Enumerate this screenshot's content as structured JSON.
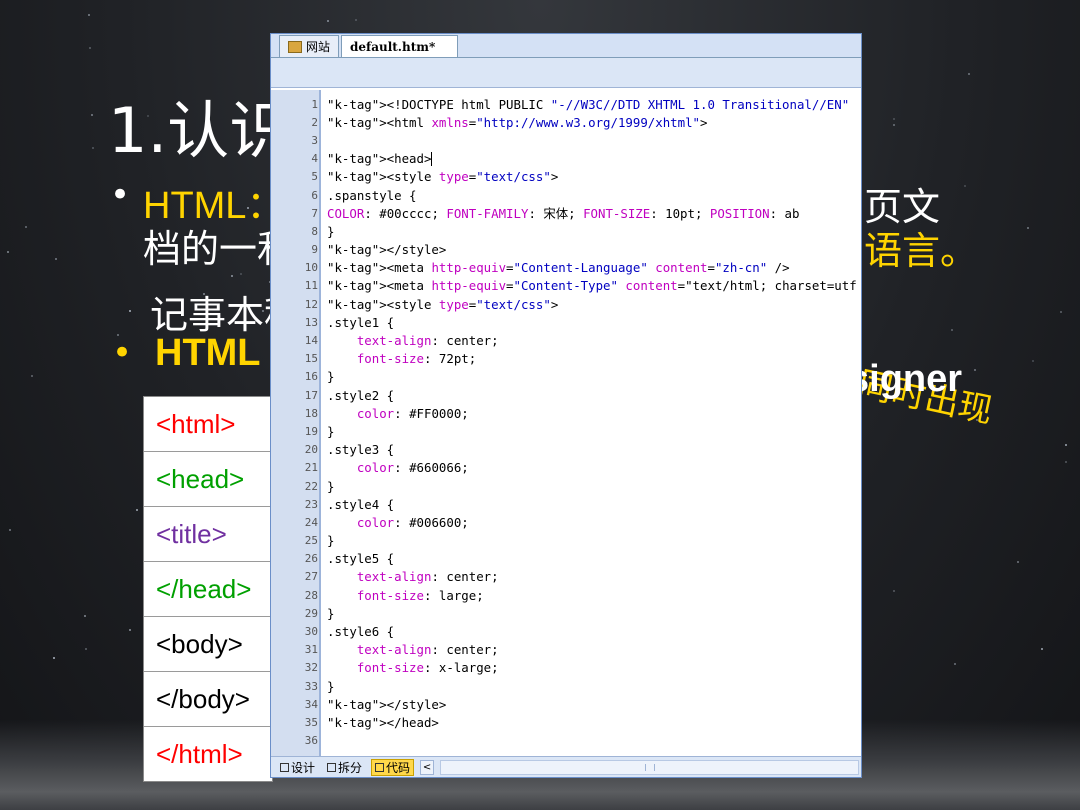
{
  "slide": {
    "title": "1.认识",
    "bullet1_label": "HTML：",
    "bullet1_cont": "档的一和",
    "bullet1_right1": "页文",
    "bullet1_right2": "语言。",
    "notepad": "记事本程",
    "bullet2_label": "HTML",
    "designer": "signer",
    "appear": "同时出现",
    "bullet_glyph": "•"
  },
  "tags": [
    {
      "text": "<html>",
      "color": "#ff0000"
    },
    {
      "text": "<head>",
      "color": "#00a000"
    },
    {
      "text": "<title>",
      "color": "#7030a0"
    },
    {
      "text": "</head>",
      "color": "#00a000"
    },
    {
      "text": "<body>",
      "color": "#000000"
    },
    {
      "text": "</body>",
      "color": "#000000"
    },
    {
      "text": "</html>",
      "color": "#ff0000"
    }
  ],
  "editor": {
    "tab_site": "网站",
    "tab_file": "default.htm*",
    "view_design": "设计",
    "view_split": "拆分",
    "view_code": "代码",
    "scroll_left": "<",
    "code_lines": [
      {
        "n": "1",
        "t": "<!DOCTYPE html PUBLIC \"-//W3C//DTD XHTML 1.0 Transitional//EN\""
      },
      {
        "n": "2",
        "t": "<html xmlns=\"http://www.w3.org/1999/xhtml\">"
      },
      {
        "n": "3",
        "t": ""
      },
      {
        "n": "4",
        "t": "<head>"
      },
      {
        "n": "5",
        "t": "<style type=\"text/css\">"
      },
      {
        "n": "6",
        "t": ".spanstyle {"
      },
      {
        "n": "7",
        "t": "COLOR: #00cccc; FONT-FAMILY: 宋体; FONT-SIZE: 10pt; POSITION: ab"
      },
      {
        "n": "8",
        "t": "}"
      },
      {
        "n": "9",
        "t": "</style>"
      },
      {
        "n": "10",
        "t": "<meta http-equiv=\"Content-Language\" content=\"zh-cn\" />"
      },
      {
        "n": "11",
        "t": "<meta http-equiv=\"Content-Type\" content=\"text/html; charset=utf"
      },
      {
        "n": "12",
        "t": "<style type=\"text/css\">"
      },
      {
        "n": "13",
        "t": ".style1 {"
      },
      {
        "n": "14",
        "t": "    text-align: center;"
      },
      {
        "n": "15",
        "t": "    font-size: 72pt;"
      },
      {
        "n": "16",
        "t": "}"
      },
      {
        "n": "17",
        "t": ".style2 {"
      },
      {
        "n": "18",
        "t": "    color: #FF0000;"
      },
      {
        "n": "19",
        "t": "}"
      },
      {
        "n": "20",
        "t": ".style3 {"
      },
      {
        "n": "21",
        "t": "    color: #660066;"
      },
      {
        "n": "22",
        "t": "}"
      },
      {
        "n": "23",
        "t": ".style4 {"
      },
      {
        "n": "24",
        "t": "    color: #006600;"
      },
      {
        "n": "25",
        "t": "}"
      },
      {
        "n": "26",
        "t": ".style5 {"
      },
      {
        "n": "27",
        "t": "    text-align: center;"
      },
      {
        "n": "28",
        "t": "    font-size: large;"
      },
      {
        "n": "29",
        "t": "}"
      },
      {
        "n": "30",
        "t": ".style6 {"
      },
      {
        "n": "31",
        "t": "    text-align: center;"
      },
      {
        "n": "32",
        "t": "    font-size: x-large;"
      },
      {
        "n": "33",
        "t": "}"
      },
      {
        "n": "34",
        "t": "</style>"
      },
      {
        "n": "35",
        "t": "</head>"
      },
      {
        "n": "36",
        "t": ""
      }
    ]
  }
}
